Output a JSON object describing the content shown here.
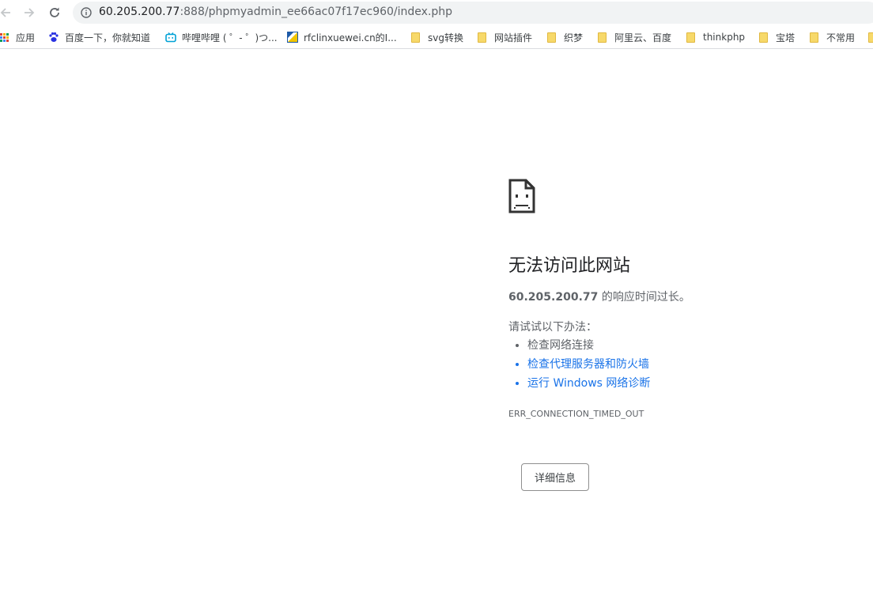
{
  "browser": {
    "back_icon": "arrow-left-icon",
    "forward_icon": "arrow-right-icon",
    "reload_icon": "reload-icon",
    "info_icon": "info-icon",
    "url_host": "60.205.200.77",
    "url_rest": ":888/phpmyadmin_ee66ac07f17ec960/index.php"
  },
  "bookmarks": [
    {
      "label": "应用",
      "icon": "apps-grid-icon"
    },
    {
      "label": "百度一下，你就知道",
      "icon": "baidu-paw-icon"
    },
    {
      "label": "哔哩哔哩 ( ゜- ゜)つ...",
      "icon": "bilibili-tv-icon"
    },
    {
      "label": "rfclinxuewei.cn的I...",
      "icon": "site-favicon-icon"
    },
    {
      "label": "svg转换",
      "icon": "folder-icon"
    },
    {
      "label": "网站插件",
      "icon": "folder-icon"
    },
    {
      "label": "织梦",
      "icon": "folder-icon"
    },
    {
      "label": "阿里云、百度",
      "icon": "folder-icon"
    },
    {
      "label": "thinkphp",
      "icon": "folder-icon"
    },
    {
      "label": "宝塔",
      "icon": "folder-icon"
    },
    {
      "label": "不常用",
      "icon": "folder-icon"
    }
  ],
  "error_page": {
    "icon": "sad-page-icon",
    "heading": "无法访问此网站",
    "host": "60.205.200.77",
    "message": " 的响应时间过长。",
    "try_label": "请试试以下办法：",
    "suggestions": [
      {
        "label": "检查网络连接",
        "link": false
      },
      {
        "label": "检查代理服务器和防火墙",
        "link": true
      },
      {
        "label": "运行 Windows 网络诊断",
        "link": true
      }
    ],
    "error_code": "ERR_CONNECTION_TIMED_OUT",
    "details_button": "详细信息"
  },
  "colors": {
    "link": "#1a73e8",
    "text": "#5f6368",
    "heading": "#202124",
    "folder": "#f7d96a"
  }
}
